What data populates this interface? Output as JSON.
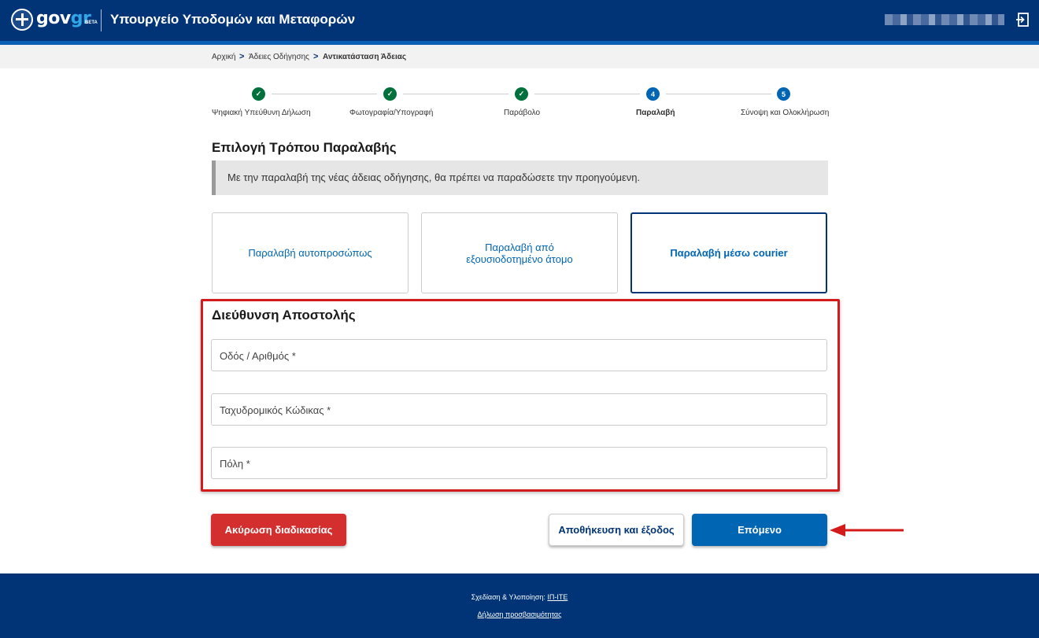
{
  "header": {
    "brand_gov": "gov",
    "brand_gr": "gr",
    "beta": "BETA",
    "ministry": "Υπουργείο Υποδομών και Μεταφορών",
    "logout_icon": "logout-icon"
  },
  "breadcrumb": {
    "items": [
      "Αρχική",
      "Άδειες Οδήγησης",
      "Αντικατάσταση Άδειας"
    ],
    "separator": ">"
  },
  "stepper": {
    "steps": [
      {
        "label": "Ψηφιακή Υπεύθυνη Δήλωση",
        "status": "done",
        "marker": "✓"
      },
      {
        "label": "Φωτογραφία/Υπογραφή",
        "status": "done",
        "marker": "✓"
      },
      {
        "label": "Παράβολο",
        "status": "done",
        "marker": "✓"
      },
      {
        "label": "Παραλαβή",
        "status": "active",
        "marker": "4"
      },
      {
        "label": "Σύνοψη και Ολοκλήρωση",
        "status": "pending",
        "marker": "5"
      }
    ]
  },
  "main": {
    "title": "Επιλογή Τρόπου Παραλαβής",
    "notice": "Με την παραλαβή της νέας άδειας οδήγησης, θα πρέπει να παραδώσετε την προηγούμενη.",
    "options": [
      {
        "label": "Παραλαβή αυτοπροσώπως",
        "selected": false
      },
      {
        "label": "Παραλαβή από εξουσιοδοτημένο άτομο",
        "selected": false
      },
      {
        "label": "Παραλαβή μέσω courier",
        "selected": true
      }
    ]
  },
  "address": {
    "title": "Διεύθυνση Αποστολής",
    "street_label": "Οδός / Αριθμός *",
    "postal_label": "Ταχυδρομικός Κώδικας *",
    "city_label": "Πόλη *"
  },
  "actions": {
    "cancel": "Ακύρωση διαδικασίας",
    "save_exit": "Αποθήκευση και έξοδος",
    "next": "Επόμενο"
  },
  "footer": {
    "credit_prefix": "Σχεδίαση & Υλοποίηση:",
    "credit_link": "ΙΠ-ΙΤΕ",
    "accessibility": "Δήλωση προσβασιμότητας"
  },
  "colors": {
    "header": "#003476",
    "accent": "#0065b3",
    "done": "#00703c",
    "cancel": "#d32f2f",
    "highlight": "#d41b1b"
  }
}
